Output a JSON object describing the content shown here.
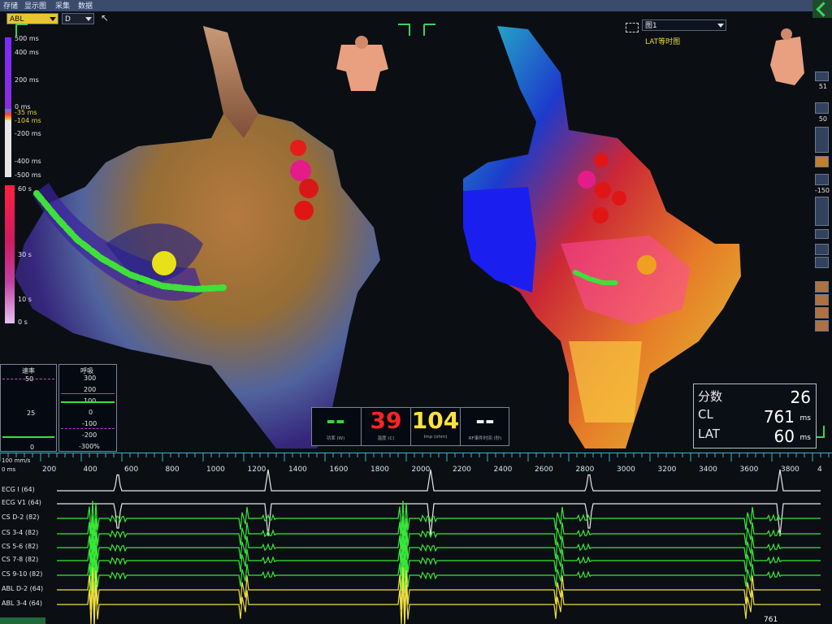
{
  "menu": {
    "items": [
      "存储",
      "显示图",
      "采集",
      "数据"
    ]
  },
  "catheter_select": {
    "value": "ABL"
  },
  "mode_select": {
    "value": "D"
  },
  "map_select": {
    "value": "图1"
  },
  "map_type": "LAT等时图",
  "lat_scale": {
    "labels": [
      "500 ms",
      "400 ms",
      "200 ms",
      "0 ms",
      "-35 ms",
      "-104 ms",
      "-200 ms",
      "-400 ms",
      "-500 ms"
    ]
  },
  "time_scale": {
    "labels": [
      "60 s",
      "30 s",
      "10 s",
      "0 s"
    ]
  },
  "rate_panel": {
    "title": "速率",
    "ticks": [
      "50",
      "25",
      "0"
    ]
  },
  "resp_panel": {
    "title": "呼吸",
    "ticks": [
      "300",
      "200",
      "100",
      "0",
      "-100",
      "-200",
      "-300%"
    ]
  },
  "vitals": [
    {
      "value": "--",
      "label": "功率 (W)",
      "color": "#3fd43f"
    },
    {
      "value": "39",
      "label": "温度 (C)",
      "color": "#ff2424"
    },
    {
      "value": "104",
      "label": "Imp (ohm)",
      "color": "#ffe23a"
    },
    {
      "value": "--",
      "label": "RF事件时间 (秒)",
      "color": "#f2f2f2"
    }
  ],
  "stats": [
    {
      "key": "分数",
      "value": "26",
      "unit": ""
    },
    {
      "key": "CL",
      "value": "761",
      "unit": "ms"
    },
    {
      "key": "LAT",
      "value": "60",
      "unit": "ms"
    }
  ],
  "right_tools": [
    "51",
    "50",
    "-150"
  ],
  "timeline": {
    "speed": "100 mm/s",
    "start": "0 ms",
    "ticks": [
      "200",
      "400",
      "600",
      "800",
      "1000",
      "1200",
      "1400",
      "1600",
      "1800",
      "2000",
      "2200",
      "2400",
      "2600",
      "2800",
      "3000",
      "3200",
      "3400",
      "3600",
      "3800",
      "4"
    ]
  },
  "channels": [
    {
      "label": "ECG I (64)",
      "color": "#e8e8e8"
    },
    {
      "label": "ECG V1 (64)",
      "color": "#e8e8e8"
    },
    {
      "label": "CS  D-2 (82)",
      "color": "#38e838"
    },
    {
      "label": "CS  3-4 (82)",
      "color": "#38e838"
    },
    {
      "label": "CS  5-6 (82)",
      "color": "#38e838"
    },
    {
      "label": "CS  7-8 (82)",
      "color": "#38e838"
    },
    {
      "label": "CS  9-10 (82)",
      "color": "#38e838"
    },
    {
      "label": "ABL  D-2 (64)",
      "color": "#f0e040"
    },
    {
      "label": "ABL  3-4 (64)",
      "color": "#f0e040"
    }
  ],
  "bottom_value": "761"
}
